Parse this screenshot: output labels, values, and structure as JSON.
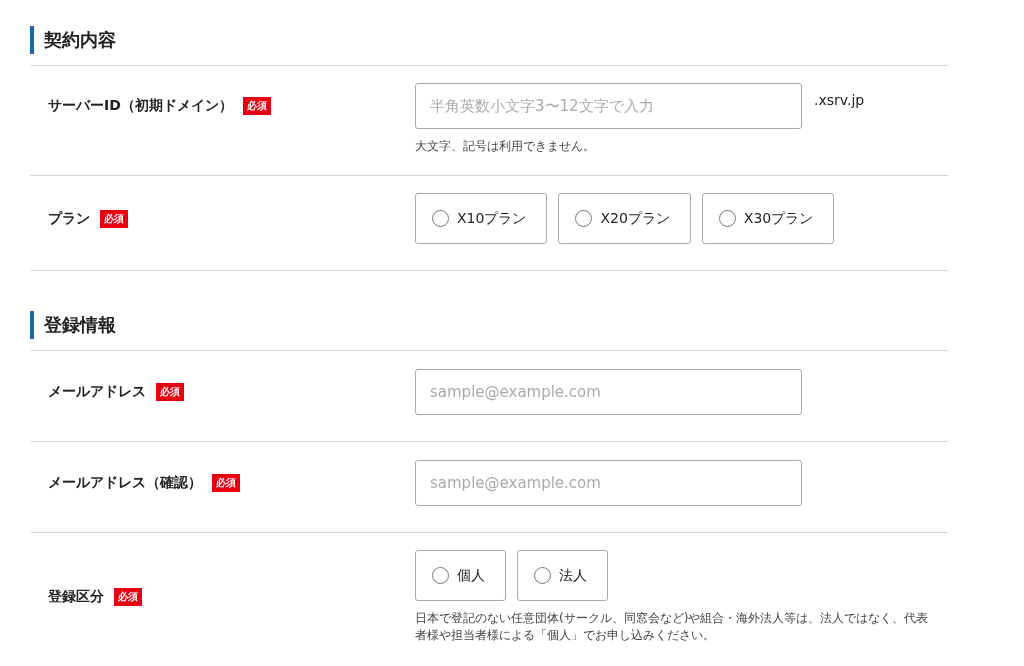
{
  "sections": [
    {
      "title": "契約内容",
      "rows": [
        {
          "label": "サーバーID（初期ドメイン）",
          "required": "必須",
          "kind": "text",
          "placeholder": "半角英数小文字3〜12文字で入力",
          "suffix": ".xsrv.jp",
          "hint": "大文字、記号は利用できません。"
        },
        {
          "label": "プラン",
          "required": "必須",
          "kind": "radio",
          "options": [
            {
              "label": "X10プラン",
              "selected": false
            },
            {
              "label": "X20プラン",
              "selected": false
            },
            {
              "label": "X30プラン",
              "selected": false
            }
          ]
        }
      ]
    },
    {
      "title": "登録情報",
      "rows": [
        {
          "label": "メールアドレス",
          "required": "必須",
          "kind": "text",
          "placeholder": "sample@example.com"
        },
        {
          "label": "メールアドレス（確認）",
          "required": "必須",
          "kind": "text",
          "placeholder": "sample@example.com"
        },
        {
          "label": "登録区分",
          "required": "必須",
          "kind": "radio",
          "options": [
            {
              "label": "個人",
              "selected": false
            },
            {
              "label": "法人",
              "selected": false
            }
          ],
          "hint": "日本で登記のない任意団体(サークル、同窓会など)や組合・海外法人等は、法人ではなく、代表者様や担当者様による「個人」でお申し込みください。"
        }
      ]
    }
  ]
}
